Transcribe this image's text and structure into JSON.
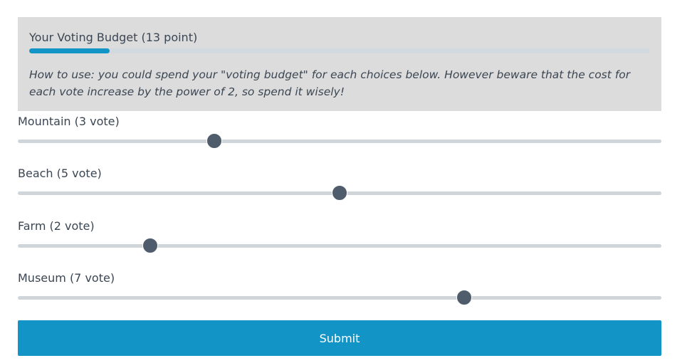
{
  "budget": {
    "title": "Your Voting Budget (13 point)",
    "used_fraction": 0.13,
    "help_text": "How to use: you could spend your \"voting budget\" for each choices below. However beware that the cost for each vote increase by the power of 2, so spend it wisely!"
  },
  "choices": [
    {
      "label": "Mountain (3 vote)",
      "votes": 3,
      "slider_fraction": 0.305
    },
    {
      "label": "Beach (5 vote)",
      "votes": 5,
      "slider_fraction": 0.5
    },
    {
      "label": "Farm (2 vote)",
      "votes": 2,
      "slider_fraction": 0.206
    },
    {
      "label": "Museum (7 vote)",
      "votes": 7,
      "slider_fraction": 0.694
    }
  ],
  "submit_label": "Submit",
  "colors": {
    "accent": "#1295c6",
    "thumb": "#4e5c6b",
    "panel": "#dcdcdc",
    "text": "#3b4653"
  }
}
